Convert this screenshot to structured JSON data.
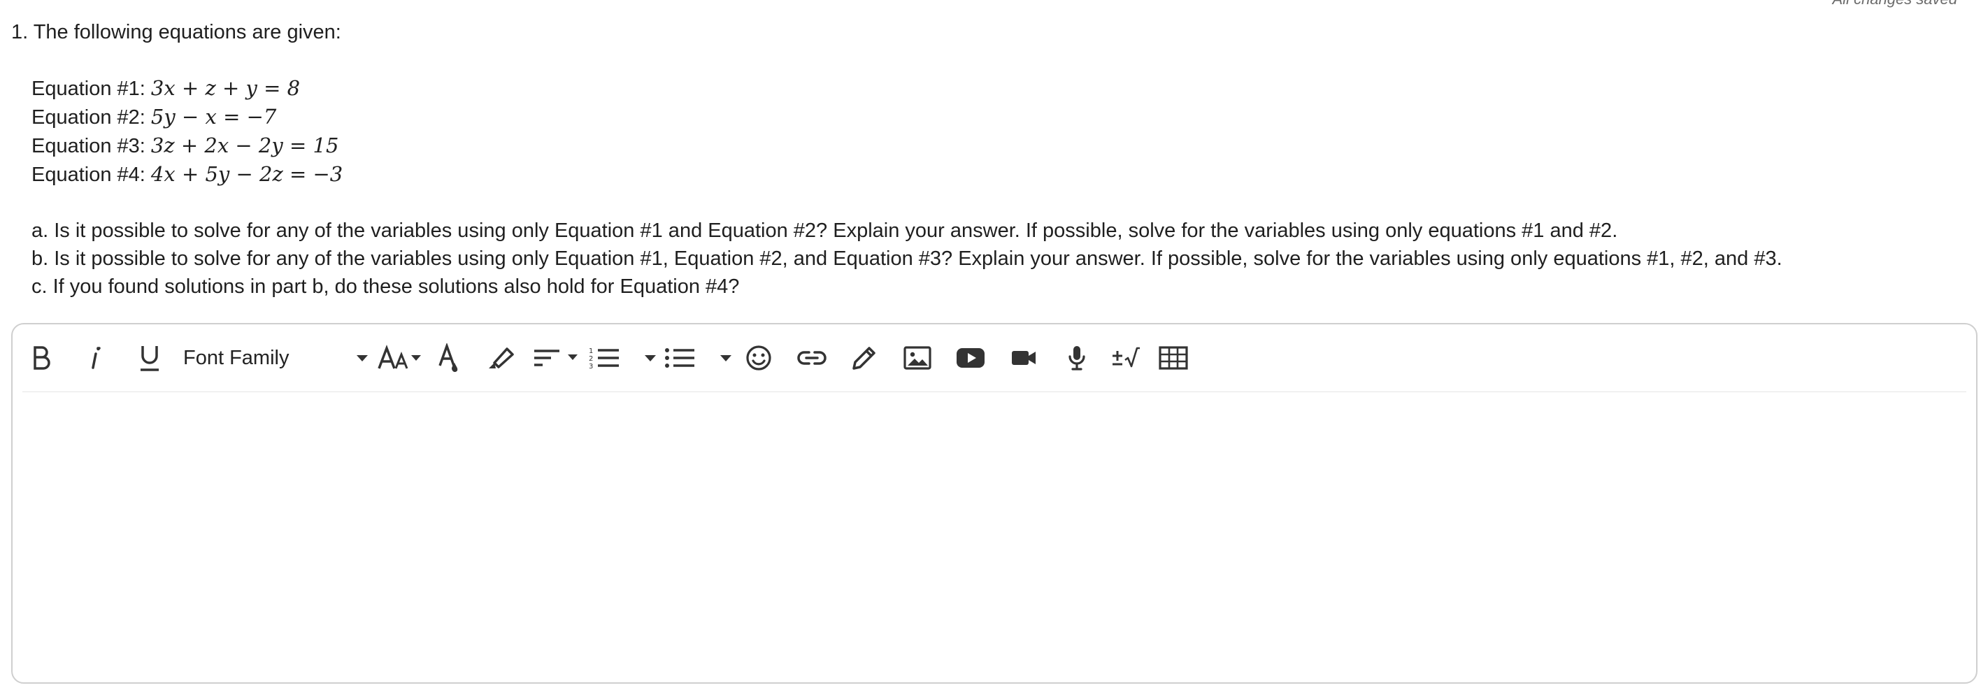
{
  "status": {
    "saved_text": "All changes saved"
  },
  "question": {
    "title": "1. The following equations are given:",
    "equations": [
      {
        "label": "Equation #1: ",
        "expr": "3x + z + y = 8"
      },
      {
        "label": "Equation #2: ",
        "expr": "5y − x = −7"
      },
      {
        "label": "Equation #3: ",
        "expr": "3z + 2x − 2y = 15"
      },
      {
        "label": "Equation #4: ",
        "expr": "4x + 5y − 2z = −3"
      }
    ],
    "parts": [
      "a. Is it possible to solve for any of the variables using only Equation #1 and Equation #2? Explain your answer. If possible, solve for the variables using only equations #1 and #2.",
      "b. Is it possible to solve for any of the variables using only Equation #1, Equation #2, and Equation #3? Explain your answer. If possible, solve for the variables using only equations #1, #2, and #3.",
      "c. If you found solutions in part b, do these solutions also hold for Equation #4?"
    ]
  },
  "toolbar": {
    "font_family_label": "Font Family",
    "icons": {
      "bold": "bold-icon",
      "italic": "italic-icon",
      "underline": "underline-icon",
      "font_size": "font-size-icon",
      "text_color": "text-color-icon",
      "highlight": "highlight-icon",
      "align": "align-icon",
      "ordered_list": "ordered-list-icon",
      "unordered_list": "unordered-list-icon",
      "emoji": "emoji-icon",
      "link": "link-icon",
      "draw": "pencil-icon",
      "image": "image-icon",
      "youtube": "youtube-icon",
      "video": "video-camera-icon",
      "audio": "microphone-icon",
      "equation": "equation-icon",
      "table": "table-icon"
    },
    "icon_color": "#333333"
  },
  "editor": {
    "content": ""
  }
}
